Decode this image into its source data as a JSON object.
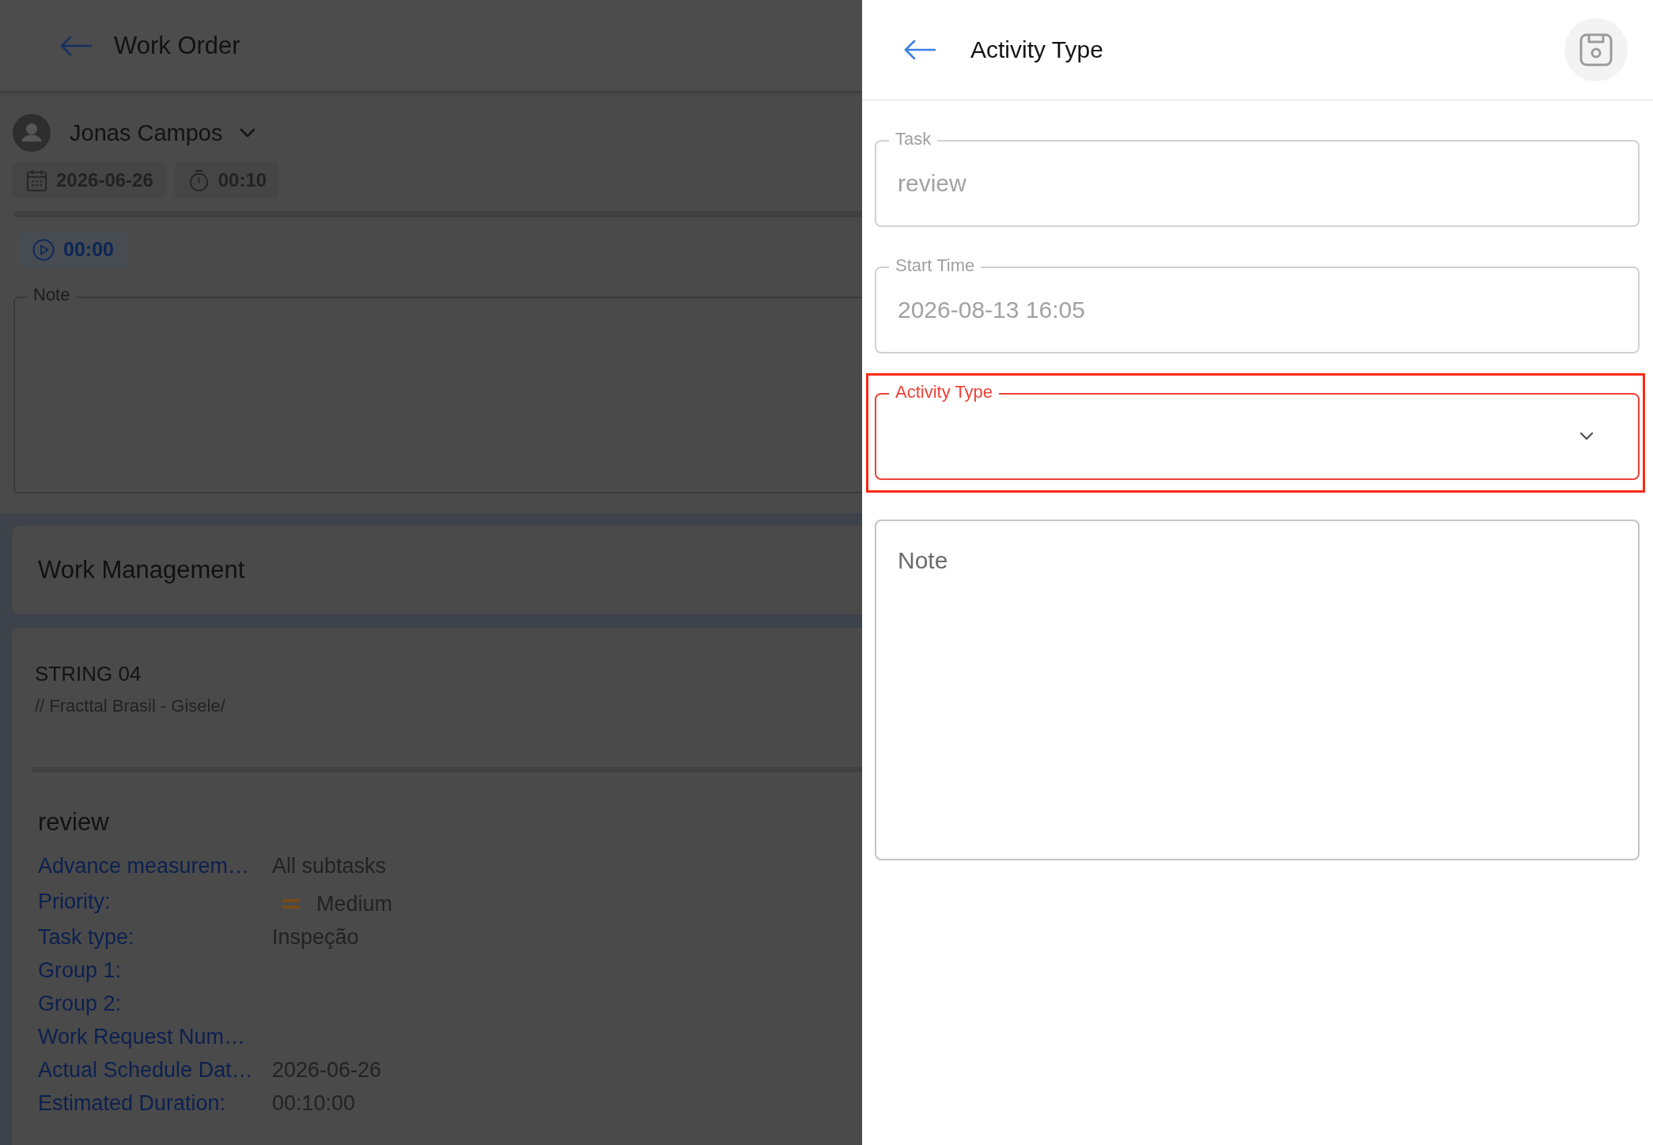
{
  "background_page": {
    "header": {
      "title": "Work Order"
    },
    "assignee": {
      "name": "Jonas Campos"
    },
    "chips": [
      {
        "kind": "date",
        "text": "2026-06-26"
      },
      {
        "kind": "duration",
        "text": "00:10"
      }
    ],
    "timer": {
      "text": "00:00"
    },
    "note_field": {
      "label": "Note"
    },
    "section": {
      "title": "Work Management"
    },
    "asset": {
      "name": "STRING 04",
      "path": "// Fracttal Brasil - Gisele/"
    },
    "task": {
      "title": "review",
      "details": [
        {
          "kind": "text",
          "label": "Advance measurem…",
          "value": "All subtasks"
        },
        {
          "kind": "priority",
          "label": "Priority:",
          "value": "Medium"
        },
        {
          "kind": "text",
          "label": "Task type:",
          "value": "Inspeção"
        },
        {
          "kind": "text",
          "label": "Group 1:"
        },
        {
          "kind": "text",
          "label": "Group 2:"
        },
        {
          "kind": "text",
          "label": "Work Request Num…"
        },
        {
          "kind": "text",
          "label": "Actual Schedule Dat…",
          "value": "2026-06-26"
        },
        {
          "kind": "text",
          "label": "Estimated Duration:",
          "value": "00:10:00"
        }
      ]
    }
  },
  "drawer": {
    "header": {
      "title": "Activity Type"
    },
    "fields": [
      {
        "kind": "text",
        "label": "Task",
        "value": "review",
        "disabled": true,
        "error": false,
        "highlighted": false
      },
      {
        "kind": "text",
        "label": "Start Time",
        "value": "2026-08-13 16:05",
        "disabled": true,
        "error": false,
        "highlighted": false
      },
      {
        "kind": "select",
        "label": "Activity Type",
        "disabled": false,
        "error": true,
        "highlighted": true
      },
      {
        "kind": "textarea",
        "placeholder": "Note",
        "disabled": false,
        "error": false,
        "highlighted": false
      }
    ]
  }
}
